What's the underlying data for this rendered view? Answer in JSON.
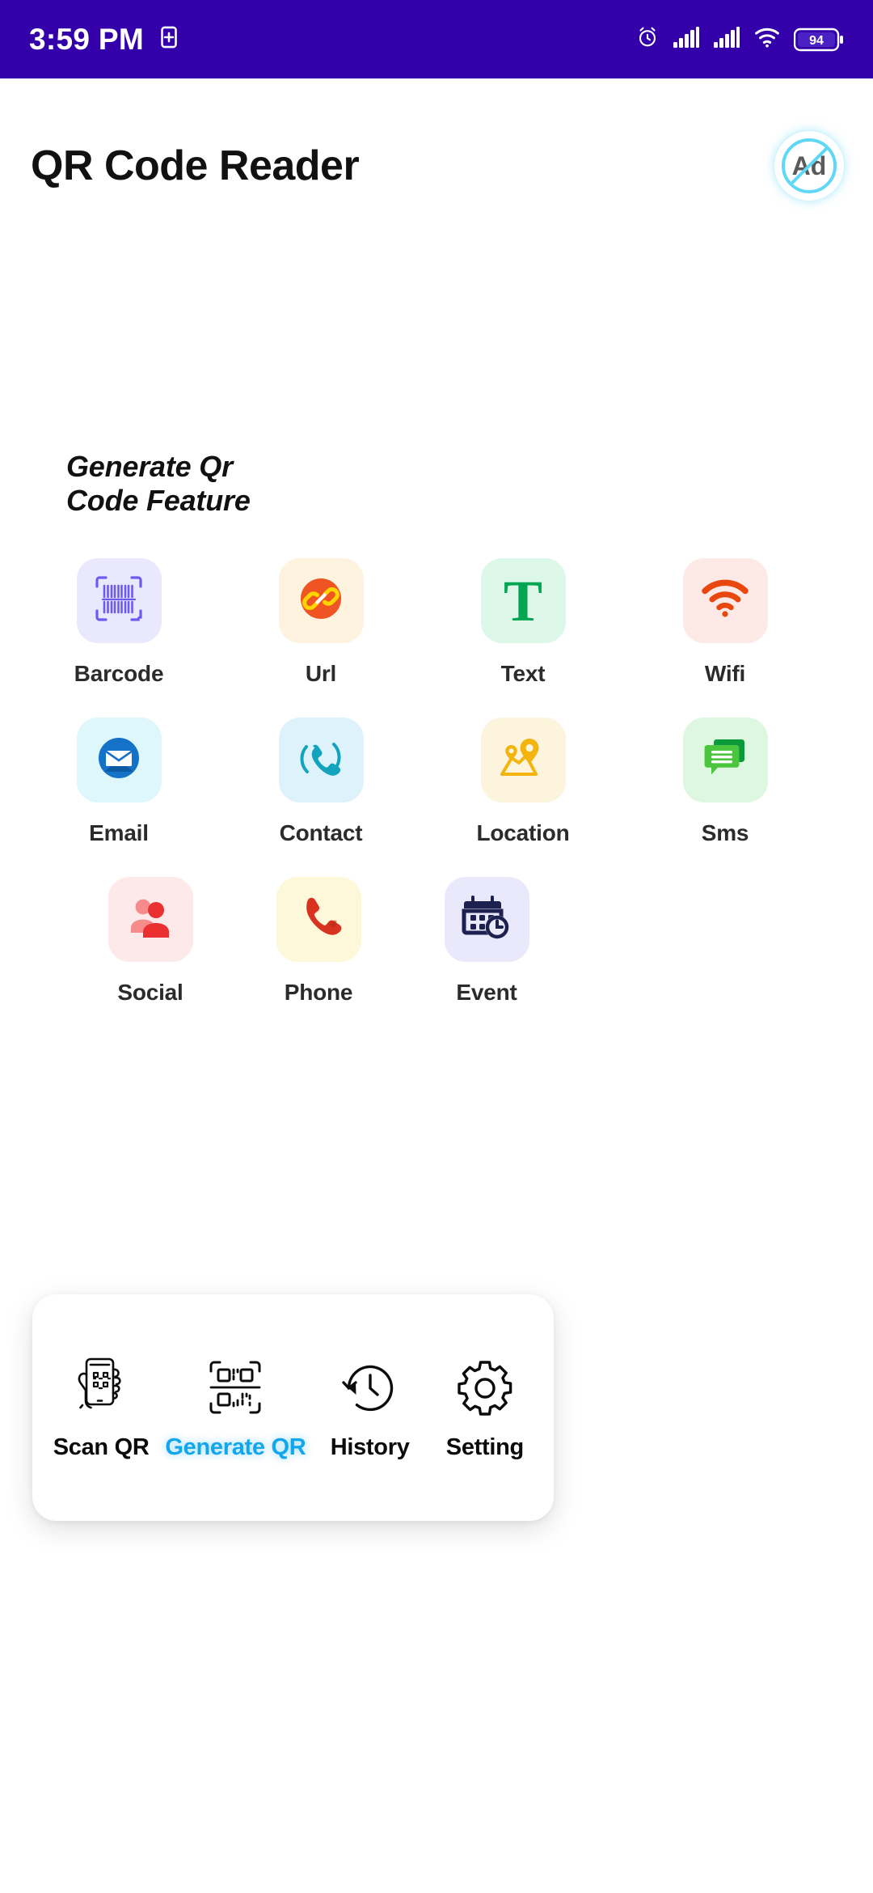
{
  "status_bar": {
    "time": "3:59 PM",
    "background_color": "#3300aa",
    "left_icons": [
      {
        "name": "split-screen-icon"
      }
    ],
    "right_icons": [
      {
        "name": "alarm-icon"
      },
      {
        "name": "signal-bars-sim1-icon"
      },
      {
        "name": "signal-bars-sim2-icon"
      },
      {
        "name": "wifi-icon"
      }
    ],
    "battery": {
      "level": "94",
      "icon": "battery-icon"
    }
  },
  "header": {
    "title": "QR Code Reader",
    "ad_badge": {
      "label": "Ad",
      "icon": "no-ads-icon",
      "accent_color": "#5fd8f5"
    }
  },
  "section": {
    "heading_line1": "Generate Qr",
    "heading_line2": "Code Feature"
  },
  "features": {
    "rows": [
      [
        {
          "label": "Barcode",
          "icon": "barcode-icon",
          "tile_color": "#eae8fd",
          "icon_color": "#6d5bf0"
        },
        {
          "label": "Url",
          "icon": "link-icon",
          "tile_color": "#fdf3df",
          "icon_color": "#f05423"
        },
        {
          "label": "Text",
          "icon": "text-t-icon",
          "tile_color": "#ddf7e8",
          "icon_color": "#00a651"
        },
        {
          "label": "Wifi",
          "icon": "wifi-icon",
          "tile_color": "#fde9e6",
          "icon_color": "#e8470d"
        }
      ],
      [
        {
          "label": "Email",
          "icon": "envelope-icon",
          "tile_color": "#def7fb",
          "icon_color": "#1472c9"
        },
        {
          "label": "Contact",
          "icon": "phone-ring-icon",
          "tile_color": "#def2fb",
          "icon_color": "#13a3bd"
        },
        {
          "label": "Location",
          "icon": "map-pin-icon",
          "tile_color": "#fdf4de",
          "icon_color": "#f2b40d"
        },
        {
          "label": "Sms",
          "icon": "chat-bubble-icon",
          "tile_color": "#ddf7e1",
          "icon_color": "#4cc53e"
        }
      ],
      [
        {
          "label": "Social",
          "icon": "people-icon",
          "tile_color": "#fde9e9",
          "icon_color": "#ea3030"
        },
        {
          "label": "Phone",
          "icon": "handset-icon",
          "tile_color": "#fdf8d9",
          "icon_color": "#d8331f"
        },
        {
          "label": "Event",
          "icon": "calendar-clock-icon",
          "tile_color": "#eae8fb",
          "icon_color": "#1d2150"
        }
      ]
    ]
  },
  "bottom_nav": {
    "active_color": "#12a7ec",
    "items": [
      {
        "label": "Scan QR",
        "icon": "scan-qr-hand-icon",
        "active": false
      },
      {
        "label": "Generate QR",
        "icon": "qr-code-icon",
        "active": true
      },
      {
        "label": "History",
        "icon": "history-clock-icon",
        "active": false
      },
      {
        "label": "Setting",
        "icon": "gear-icon",
        "active": false
      }
    ]
  }
}
